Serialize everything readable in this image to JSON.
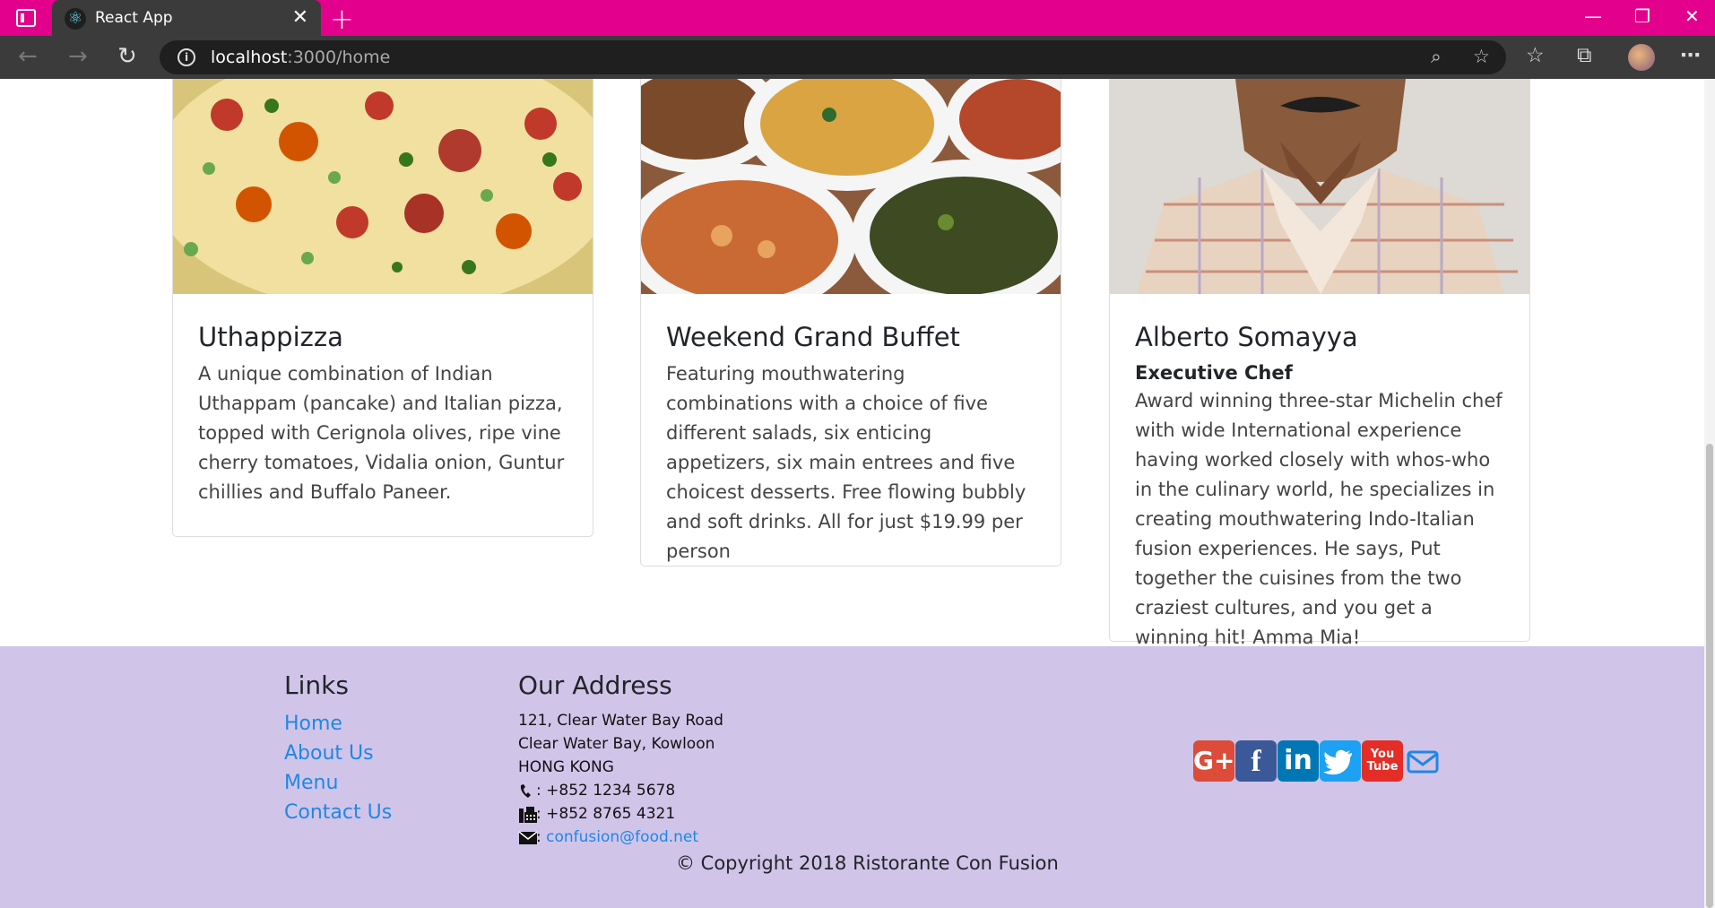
{
  "browser": {
    "tab_title": "React App",
    "url_host": "localhost",
    "url_rest": ":3000/home"
  },
  "cards": [
    {
      "name": "Uthappizza",
      "description": "A unique combination of Indian Uthappam (pancake) and Italian pizza, topped with Cerignola olives, ripe vine cherry tomatoes, Vidalia onion, Guntur chillies and Buffalo Paneer."
    },
    {
      "name": "Weekend Grand Buffet",
      "description": "Featuring mouthwatering combinations with a choice of five different salads, six enticing appetizers, six main entrees and five choicest desserts. Free flowing bubbly and soft drinks. All for just $19.99 per person"
    },
    {
      "name": "Alberto Somayya",
      "designation": "Executive Chef",
      "description": "Award winning three-star Michelin chef with wide International experience having worked closely with whos-who in the culinary world, he specializes in creating mouthwatering Indo-Italian fusion experiences. He says, Put together the cuisines from the two craziest cultures, and you get a winning hit! Amma Mia!"
    }
  ],
  "footer": {
    "links_heading": "Links",
    "links": [
      "Home",
      "About Us",
      "Menu",
      "Contact Us"
    ],
    "address_heading": "Our Address",
    "address_lines": [
      "121, Clear Water Bay Road",
      "Clear Water Bay, Kowloon",
      "HONG KONG"
    ],
    "phone": ": +852 1234 5678",
    "fax": ": +852 8765 4321",
    "email_prefix": ":",
    "email": "confusion@food.net",
    "social_icons": [
      "google-plus-icon",
      "facebook-icon",
      "linkedin-icon",
      "twitter-icon",
      "youtube-icon",
      "envelope-icon"
    ],
    "youtube_label": "You Tube",
    "copyright": "© Copyright 2018 Ristorante Con Fusion"
  },
  "colors": {
    "tab_bar": "#e3008c",
    "footer_bg": "#d1c4e9",
    "link": "#1e88e5"
  }
}
